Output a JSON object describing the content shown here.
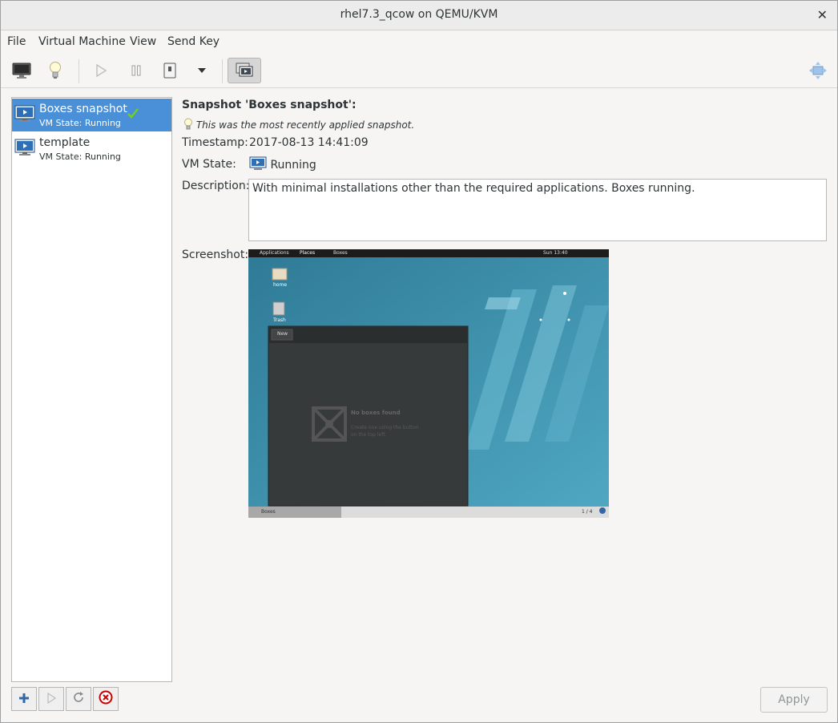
{
  "window": {
    "title": "rhel7.3_qcow on QEMU/KVM",
    "close_glyph": "✕"
  },
  "menu": [
    "File",
    "Virtual Machine",
    "View",
    "Send Key"
  ],
  "toolbar": {
    "icons": [
      "console-monitor-icon",
      "details-lightbulb-icon",
      "run-play-icon",
      "pause-icon",
      "shutdown-icon",
      "dropdown-arrow-icon",
      "snapshots-icon",
      "fullscreen-icon"
    ]
  },
  "snapshots": [
    {
      "name": "Boxes snapshot",
      "state": "VM State: Running",
      "current": true
    },
    {
      "name": "template",
      "state": "VM State: Running",
      "current": false
    }
  ],
  "details": {
    "heading": "Snapshot 'Boxes snapshot':",
    "hint": "This was the most recently applied snapshot.",
    "timestamp_label": "Timestamp:",
    "timestamp_value": "2017-08-13 14:41:09",
    "vmstate_label": "VM State:",
    "vmstate_value": "Running",
    "description_label": "Description:",
    "description_value": "With minimal installations other than the required applications. Boxes running.",
    "screenshot_label": "Screenshot:"
  },
  "guest_screen": {
    "topbar_applications": "Applications",
    "topbar_places": "Places",
    "topbar_app": "Boxes",
    "clock": "Sun 13:40",
    "desktop_icons": [
      "home",
      "Trash"
    ],
    "boxes_new_button": "New",
    "empty_title": "No boxes found",
    "empty_line1": "Create one using the button",
    "empty_line2": "on the top left.",
    "taskbar_item": "Boxes",
    "workspace": "1 / 4"
  },
  "colors": {
    "selection": "#4a90d9",
    "check": "#73d216",
    "delete": "#cc0000",
    "add": "#3465a4"
  },
  "buttons": {
    "apply": "Apply"
  }
}
